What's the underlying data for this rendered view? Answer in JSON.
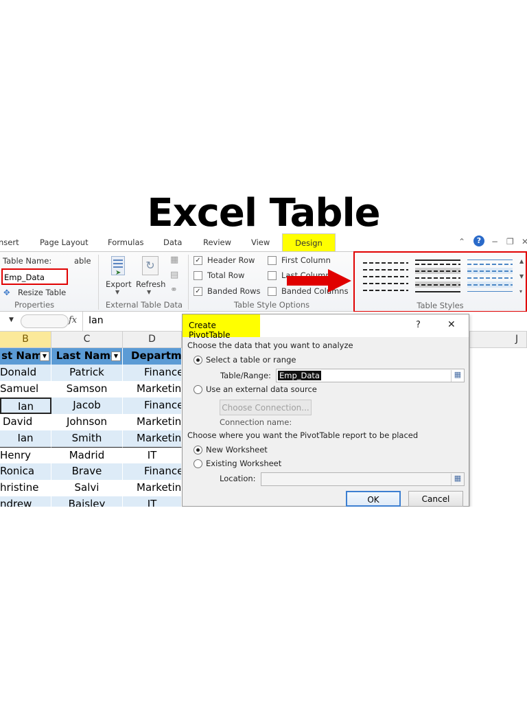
{
  "heading": "Excel Table",
  "tabs": [
    "nsert",
    "Page Layout",
    "Formulas",
    "Data",
    "Review",
    "View"
  ],
  "active_tab": "Design",
  "highlight_color": "#ffff00",
  "callout_color": "#e00000",
  "ribbon": {
    "table_name_label": "Table Name:",
    "table_name_value": "Emp_Data",
    "resize_table": "Resize Table",
    "cut_label": "able",
    "properties_group": "Properties",
    "export": "Export",
    "refresh": "Refresh",
    "external_group": "External Table Data",
    "options": {
      "header_row": "Header Row",
      "total_row": "Total Row",
      "banded_rows": "Banded Rows",
      "first_column": "First Column",
      "last_column": "Last Column",
      "banded_columns": "Banded Columns",
      "group": "Table Style Options"
    },
    "styles_group": "Table Styles"
  },
  "formula_bar": {
    "fx": "fx",
    "value": "Ian"
  },
  "columns": [
    "B",
    "C",
    "D",
    "J"
  ],
  "table": {
    "headers": [
      "st Name",
      "Last Name",
      "Departme"
    ],
    "rows": [
      [
        "Donald",
        "Patrick",
        "Finance"
      ],
      [
        "Samuel",
        "Samson",
        "Marketin"
      ],
      [
        "Ian",
        "Jacob",
        "Finance"
      ],
      [
        "David",
        "Johnson",
        "Marketin"
      ],
      [
        "Ian",
        "Smith",
        "Marketin"
      ],
      [
        "Henry",
        "Madrid",
        "IT"
      ],
      [
        "Ronica",
        "Brave",
        "Finance"
      ],
      [
        "hristine",
        "Salvi",
        "Marketin"
      ],
      [
        "ndrew",
        "Baisley",
        "IT"
      ]
    ]
  },
  "dialog": {
    "title": "Create PivotTable",
    "help": "?",
    "close": "✕",
    "section1": "Choose the data that you want to analyze",
    "opt_select_range": "Select a table or range",
    "table_range_label": "Table/Range:",
    "table_range_value": "Emp_Data",
    "opt_external": "Use an external data source",
    "choose_connection": "Choose Connection...",
    "connection_name": "Connection name:",
    "section2": "Choose where you want the PivotTable report to be placed",
    "opt_new_ws": "New Worksheet",
    "opt_existing_ws": "Existing Worksheet",
    "location_label": "Location:",
    "ok": "OK",
    "cancel": "Cancel"
  }
}
